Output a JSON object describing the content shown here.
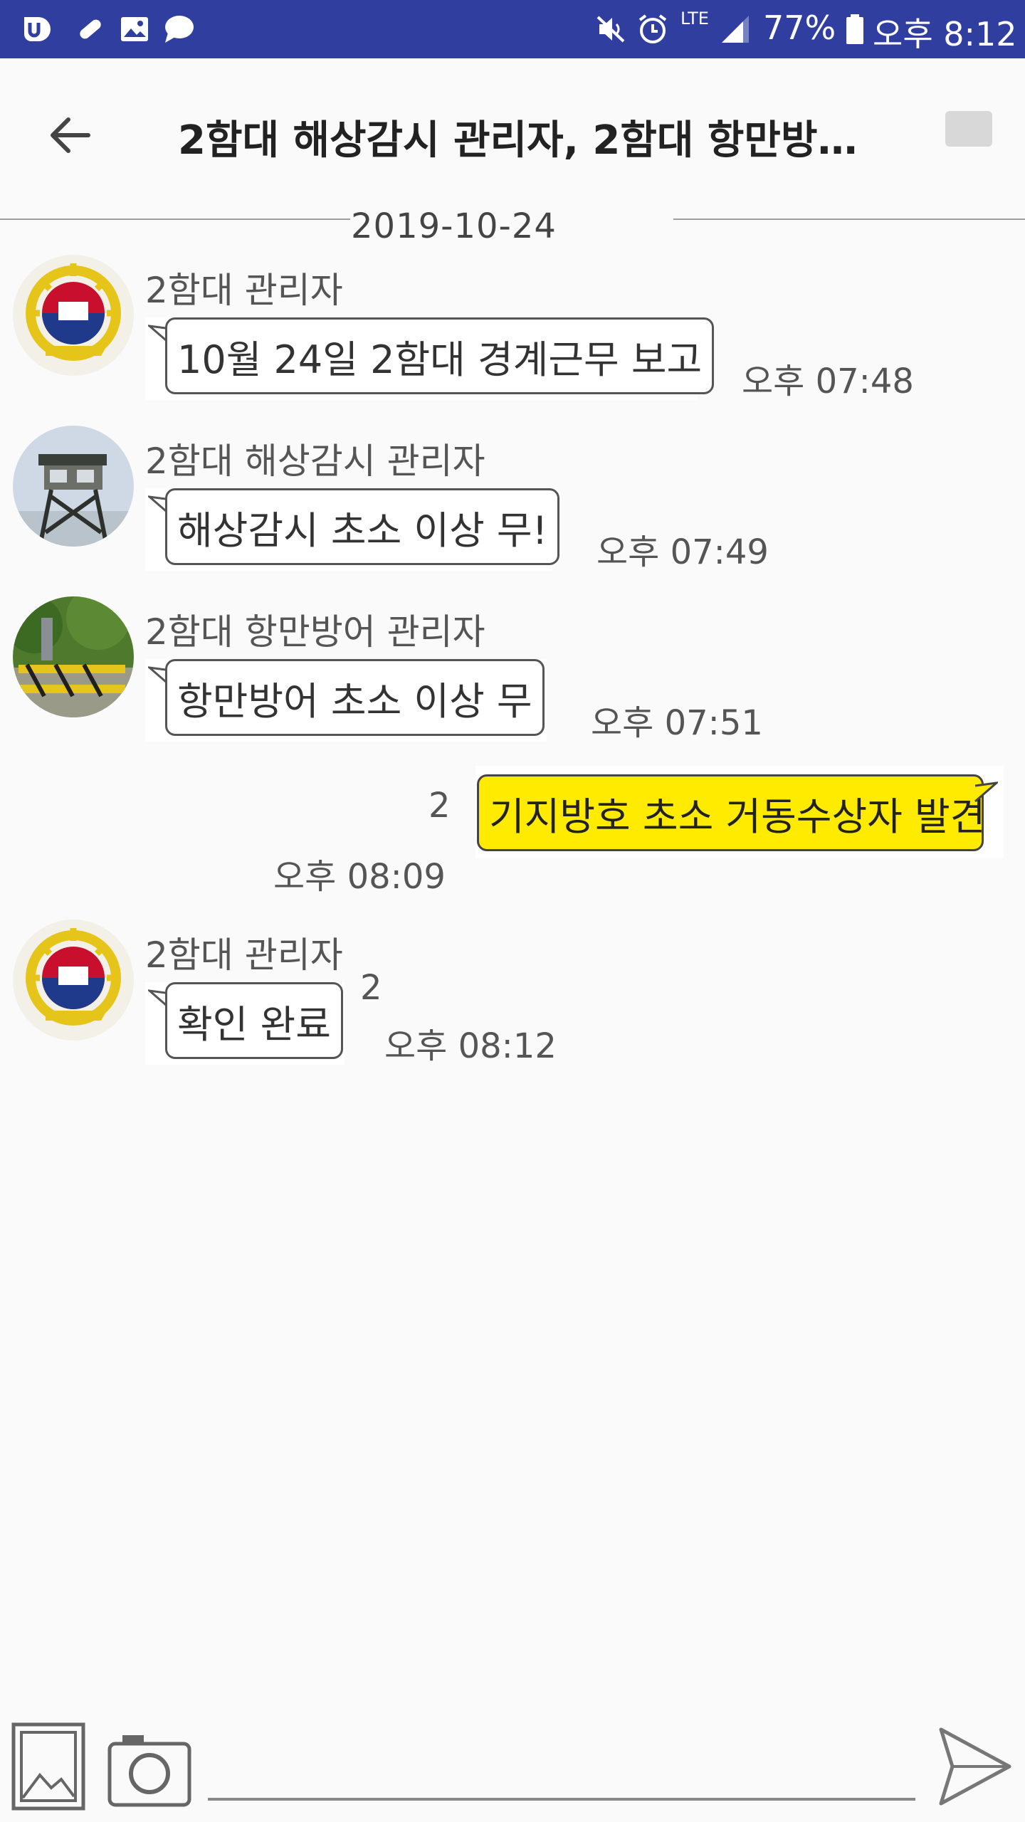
{
  "status_bar": {
    "battery": "77%",
    "time": "오후 8:12",
    "network": "LTE",
    "background_color": "#303f9f"
  },
  "header": {
    "title": "2함대 해상감시 관리자, 2함대 항만방…",
    "back_icon": "arrow-left-icon",
    "menu_icon": "menu-icon"
  },
  "date_divider": "2019-10-24",
  "messages": [
    {
      "sender": "2함대 관리자",
      "text": "10월 24일 2함대 경계근무 보고",
      "time": "오후 07:48",
      "avatar": "navy-fleet-emblem"
    },
    {
      "sender": "2함대 해상감시 관리자",
      "text": "해상감시 초소 이상 무!",
      "time": "오후 07:49",
      "avatar": "watchtower-photo"
    },
    {
      "sender": "2함대 항만방어 관리자",
      "text": "항만방어 초소 이상 무",
      "time": "오후 07:51",
      "avatar": "port-barrier-photo"
    },
    {
      "sender": "me",
      "text": "기지방호 초소 거동수상자 발견",
      "time": "오후 08:09",
      "unread": "2",
      "bubble_color": "#ffeb00"
    },
    {
      "sender": "2함대 관리자",
      "text": "확인 완료",
      "time": "오후 08:12",
      "unread": "2",
      "avatar": "navy-fleet-emblem"
    }
  ],
  "input_bar": {
    "placeholder": "",
    "gallery_icon": "image-icon",
    "camera_icon": "camera-icon",
    "send_icon": "send-icon"
  }
}
